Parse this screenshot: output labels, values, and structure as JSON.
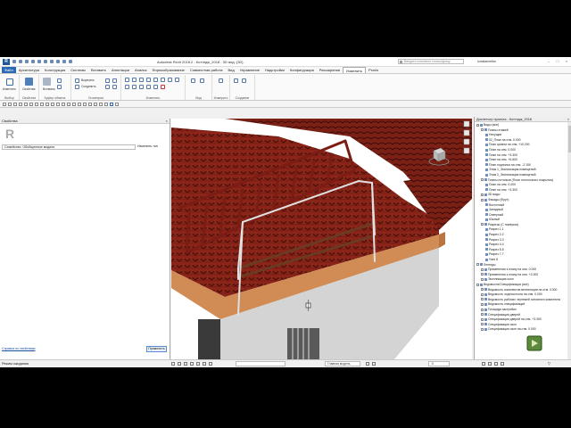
{
  "app": {
    "title": "Autodesk Revit 2018.2 - Коттедж_2018 - 3D вид: {3D}",
    "search_placeholder": "Введите ключевое слово/фразу",
    "user": "lomstanrelitm",
    "window_buttons": [
      "–",
      "□",
      "×"
    ]
  },
  "menu_tabs": [
    "Файл",
    "Архитектура",
    "Конструкция",
    "Системы",
    "Вставить",
    "Аннотации",
    "Анализ",
    "Формообразование",
    "Совместная работа",
    "Вид",
    "Управление",
    "Надстройки",
    "Конфигурация",
    "Расширения",
    "Изменить",
    "Provis"
  ],
  "active_tab": "Изменить",
  "ribbon": {
    "groups": [
      {
        "label": "Выбор",
        "buttons": [
          "Изменить"
        ]
      },
      {
        "label": "Свойства",
        "buttons": [
          "Свойства"
        ]
      },
      {
        "label": "Буфер обмена",
        "buttons": [
          "Вставить"
        ]
      },
      {
        "label": "Геометрия",
        "buttons": [
          "Вырезать",
          "Соединить"
        ]
      },
      {
        "label": "Изменить",
        "buttons": []
      },
      {
        "label": "Вид",
        "buttons": []
      },
      {
        "label": "Измерить",
        "buttons": []
      },
      {
        "label": "Создание",
        "buttons": []
      }
    ]
  },
  "properties": {
    "title": "Свойства",
    "family_selector": "Семейство: Обобщенные модели",
    "edit_type": "Изменить тип",
    "help_link": "Справка по свойствам",
    "apply": "Применить"
  },
  "project_browser": {
    "title": "Диспетчер проекта - Коттедж_2018",
    "nodes": [
      {
        "level": 0,
        "label": "Виды (все)"
      },
      {
        "level": 1,
        "label": "Планы этажей"
      },
      {
        "level": 2,
        "label": "Несущие"
      },
      {
        "level": 2,
        "label": "02_План на отм. 0.000"
      },
      {
        "level": 2,
        "label": "План кровли на отм. +10.200"
      },
      {
        "level": 2,
        "label": "План на отм. 0.000"
      },
      {
        "level": 2,
        "label": "План на отм. +3.300"
      },
      {
        "level": 2,
        "label": "План на отм. +6.600"
      },
      {
        "level": 2,
        "label": "План подполья на отм. -2.150"
      },
      {
        "level": 2,
        "label": "Этаж 1_Экспликация помещений"
      },
      {
        "level": 2,
        "label": "Этаж 2_Экспликация помещений"
      },
      {
        "level": 1,
        "label": "Планы потолков (План потолочного покрытия)"
      },
      {
        "level": 2,
        "label": "План на отм. 0.000"
      },
      {
        "level": 2,
        "label": "План на отм. +3.300"
      },
      {
        "level": 1,
        "label": "3D виды"
      },
      {
        "level": 1,
        "label": "Фасады (Фрут)"
      },
      {
        "level": 2,
        "label": "Восточный"
      },
      {
        "level": 2,
        "label": "Западный"
      },
      {
        "level": 2,
        "label": "Северный"
      },
      {
        "level": 2,
        "label": "Южный"
      },
      {
        "level": 1,
        "label": "Разрезы (С номером)"
      },
      {
        "level": 2,
        "label": "Разрез 1-1"
      },
      {
        "level": 2,
        "label": "Разрез 2-2"
      },
      {
        "level": 2,
        "label": "Разрез 3-3"
      },
      {
        "level": 2,
        "label": "Разрез 4-4"
      },
      {
        "level": 2,
        "label": "Разрез 5-5"
      },
      {
        "level": 2,
        "label": "Разрез 7-7"
      },
      {
        "level": 2,
        "label": "Узел 8"
      },
      {
        "level": 0,
        "label": "Легенды"
      },
      {
        "level": 1,
        "label": "Применения к плану на отм. 0.000"
      },
      {
        "level": 1,
        "label": "Применения к плану на отм. +3.300"
      },
      {
        "level": 1,
        "label": "Экспликация окон"
      },
      {
        "level": 0,
        "label": "Ведомости/Спецификации (все)"
      },
      {
        "level": 1,
        "label": "Ведомость комплектов вентиляции на отм. 0.000"
      },
      {
        "level": 1,
        "label": "Ведомость отделки пола на отм. 0.000"
      },
      {
        "level": 1,
        "label": "Ведомость рабочих чертежей основного комплекта"
      },
      {
        "level": 1,
        "label": "Ведомость спецификаций"
      },
      {
        "level": 1,
        "label": "Площади застройки"
      },
      {
        "level": 1,
        "label": "Спецификация дверей"
      },
      {
        "level": 1,
        "label": "Спецификация дверей на отм. +3.300"
      },
      {
        "level": 1,
        "label": "Спецификация окон"
      },
      {
        "level": 1,
        "label": "Спецификация окон на отм. 0.000"
      }
    ]
  },
  "status": {
    "message": "Режим ожидания",
    "model_field": "Главная модель",
    "scale_field": ":0"
  },
  "colors": {
    "roof_tile": "#8a2418",
    "roof_tile_dark": "#4a0f0a",
    "fascia_wood": "#d08c54",
    "wall_gray": "#c8c8c8",
    "guard_rail": "#7b1c15",
    "snow_bar": "#e0e0e0",
    "file_tab": "#2a6ab5"
  }
}
